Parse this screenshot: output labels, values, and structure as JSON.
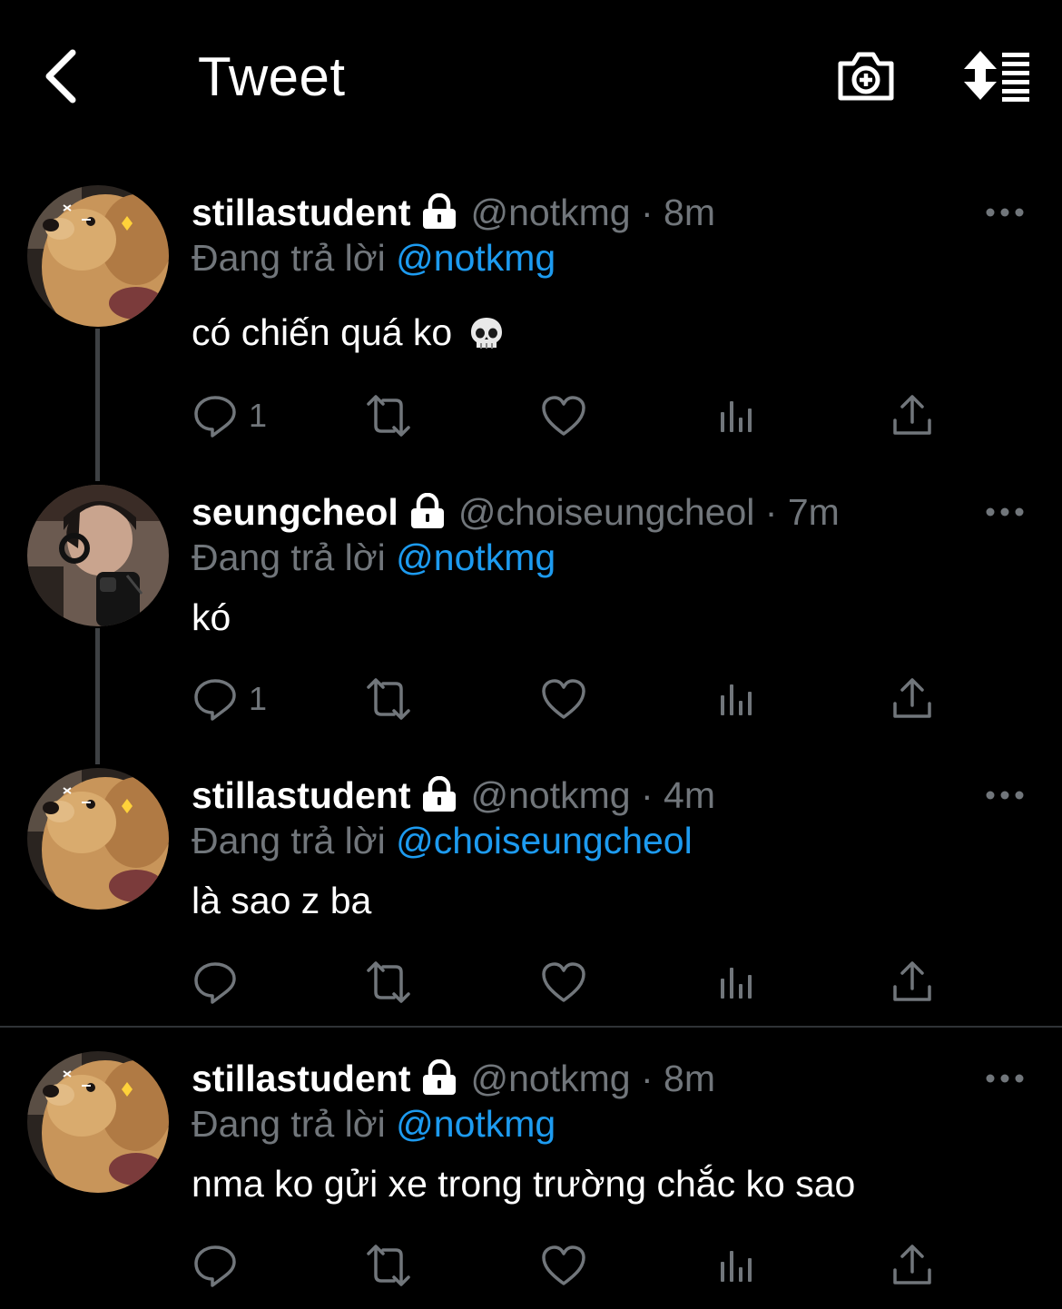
{
  "header": {
    "title": "Tweet",
    "back_icon": "chevron-left-icon",
    "camera_icon": "camera-plus-icon",
    "sort_icon": "sort-list-icon"
  },
  "colors": {
    "background": "#000000",
    "text": "#ffffff",
    "secondary": "#71767b",
    "accent": "#1d9bf0",
    "divider": "#2f3336"
  },
  "tweets": [
    {
      "display_name": "stillastudent",
      "handle": "@notkmg",
      "separator": "·",
      "time": "8m",
      "reply_prefix": "Đang trả lời",
      "reply_to": "@notkmg",
      "text": "có chiến quá ko",
      "emoji": "skull-emoji",
      "avatar": "dog-avatar",
      "reply_count": "1"
    },
    {
      "display_name": "seungcheol",
      "handle": "@choiseungcheol",
      "separator": "·",
      "time": "7m",
      "reply_prefix": "Đang trả lời",
      "reply_to": "@notkmg",
      "text": "kó",
      "avatar": "person-selfie-avatar",
      "reply_count": "1"
    },
    {
      "display_name": "stillastudent",
      "handle": "@notkmg",
      "separator": "·",
      "time": "4m",
      "reply_prefix": "Đang trả lời",
      "reply_to": "@choiseungcheol",
      "text": "là sao z ba",
      "avatar": "dog-avatar",
      "reply_count": ""
    },
    {
      "display_name": "stillastudent",
      "handle": "@notkmg",
      "separator": "·",
      "time": "8m",
      "reply_prefix": "Đang trả lời",
      "reply_to": "@notkmg",
      "text": "nma ko gửi xe trong trường chắc ko sao",
      "avatar": "dog-avatar",
      "reply_count": ""
    }
  ]
}
